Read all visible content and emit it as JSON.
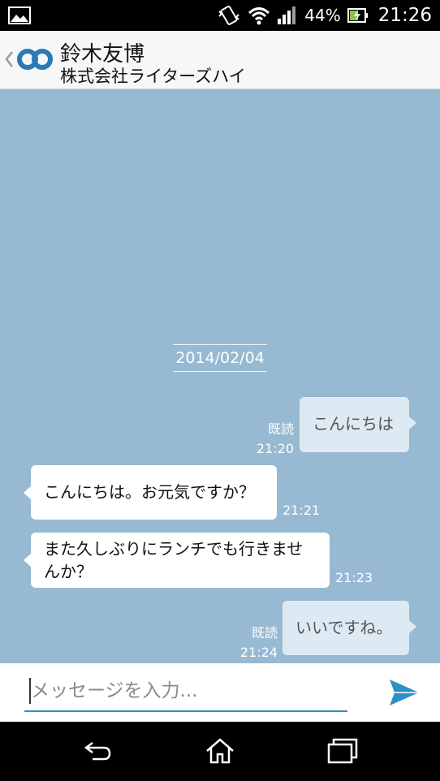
{
  "status_bar": {
    "battery_percent": "44%",
    "time": "21:26",
    "icons": [
      "gallery-icon",
      "vibrate-icon",
      "wifi-icon",
      "signal-icon",
      "battery-charging-icon"
    ]
  },
  "header": {
    "contact_name": "鈴木友博",
    "company": "株式会社ライターズハイ"
  },
  "chat": {
    "date": "2014/02/04",
    "messages": [
      {
        "direction": "out",
        "text": "こんにちは",
        "read": "既読",
        "time": "21:20"
      },
      {
        "direction": "in",
        "text": "こんにちは。お元気ですか？",
        "time": "21:21"
      },
      {
        "direction": "in",
        "line1": "また久しぶりにランチでも行きませ",
        "line2": "んか？",
        "time": "21:23"
      },
      {
        "direction": "out",
        "text": "いいですね。",
        "read": "既読",
        "time": "21:24"
      }
    ]
  },
  "composer": {
    "placeholder": "メッセージを入力...",
    "value": ""
  },
  "colors": {
    "chat_background": "#97b9d2",
    "outgoing_bubble": "#ddeaf3",
    "incoming_bubble": "#ffffff",
    "accent": "#2e8fc8"
  }
}
